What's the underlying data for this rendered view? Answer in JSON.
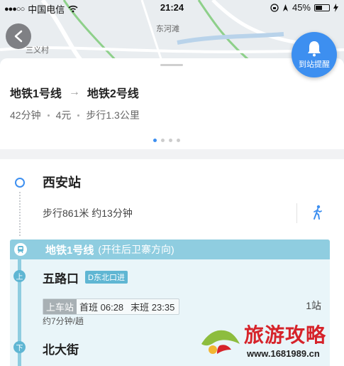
{
  "status_bar": {
    "signal_dots": "●●●○○",
    "carrier": "中国电信",
    "time": "21:24",
    "battery_percent": "45%"
  },
  "map": {
    "labels": [
      "三义村",
      "东河滩"
    ],
    "back_icon": "chevron-left-icon",
    "alert_button_label": "到站提醒",
    "alert_icon": "bell-icon"
  },
  "route": {
    "from_line": "地铁1号线",
    "arrow": "→",
    "to_line": "地铁2号线",
    "duration": "42分钟",
    "fare": "4元",
    "walk_distance": "步行1.3公里",
    "page_count": 4,
    "active_page": 0
  },
  "detail": {
    "start_station": "西安站",
    "walk_text": "步行861米 约13分钟",
    "walk_icon": "walking-person-icon",
    "line_name": "地铁1号线",
    "line_direction": "(开往后卫寨方向)",
    "board_badge": "上",
    "board_station": "五路口",
    "board_exit": "D东北口进",
    "board_tag": "上车站",
    "first_train": "首班 06:28",
    "last_train": "末班 23:35",
    "stops_count": "1站",
    "frequency": "约7分钟/趟",
    "alight_badge": "下",
    "alight_station": "北大街"
  },
  "watermark": {
    "logo_text": "旅游攻略",
    "url": "www.1681989.cn"
  },
  "colors": {
    "accent_blue": "#3d8ff0",
    "metro_line1": "#8fcde0",
    "map_bg": "#e9edf0"
  }
}
